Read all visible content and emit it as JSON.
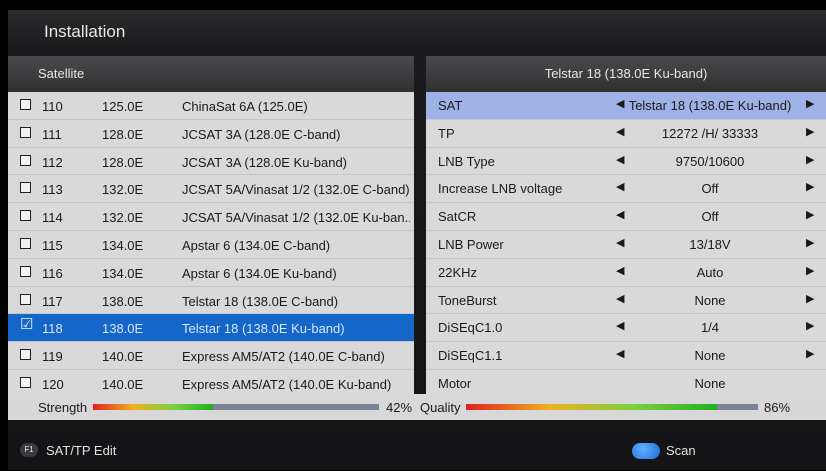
{
  "header": {
    "title": "Installation"
  },
  "left_panel": {
    "title": "Satellite",
    "rows": [
      {
        "num": "110",
        "pos": "125.0E",
        "name": "ChinaSat 6A (125.0E)",
        "checked": false
      },
      {
        "num": "111",
        "pos": "128.0E",
        "name": "JCSAT 3A (128.0E C-band)",
        "checked": false
      },
      {
        "num": "112",
        "pos": "128.0E",
        "name": "JCSAT 3A (128.0E Ku-band)",
        "checked": false
      },
      {
        "num": "113",
        "pos": "132.0E",
        "name": "JCSAT 5A/Vinasat 1/2 (132.0E C-band)",
        "checked": false
      },
      {
        "num": "114",
        "pos": "132.0E",
        "name": "JCSAT 5A/Vinasat 1/2 (132.0E Ku-ban...",
        "checked": false
      },
      {
        "num": "115",
        "pos": "134.0E",
        "name": "Apstar 6 (134.0E C-band)",
        "checked": false
      },
      {
        "num": "116",
        "pos": "134.0E",
        "name": "Apstar 6 (134.0E Ku-band)",
        "checked": false
      },
      {
        "num": "117",
        "pos": "138.0E",
        "name": "Telstar 18 (138.0E C-band)",
        "checked": false
      },
      {
        "num": "118",
        "pos": "138.0E",
        "name": "Telstar 18 (138.0E Ku-band)",
        "checked": true,
        "selected": true
      },
      {
        "num": "119",
        "pos": "140.0E",
        "name": "Express AM5/AT2 (140.0E C-band)",
        "checked": false
      },
      {
        "num": "120",
        "pos": "140.0E",
        "name": "Express AM5/AT2 (140.0E Ku-band)",
        "checked": false
      }
    ]
  },
  "right_panel": {
    "title": "Telstar 18 (138.0E Ku-band)",
    "params": [
      {
        "label": "SAT",
        "value": "Telstar 18 (138.0E Ku-band)",
        "arrows": true,
        "selected": true
      },
      {
        "label": "TP",
        "value": "12272 /H/ 33333",
        "arrows": true
      },
      {
        "label": "LNB Type",
        "value": "9750/10600",
        "arrows": true
      },
      {
        "label": "Increase LNB voltage",
        "value": "Off",
        "arrows": true
      },
      {
        "label": "SatCR",
        "value": "Off",
        "arrows": true
      },
      {
        "label": "LNB Power",
        "value": "13/18V",
        "arrows": true
      },
      {
        "label": "22KHz",
        "value": "Auto",
        "arrows": true
      },
      {
        "label": "ToneBurst",
        "value": "None",
        "arrows": true
      },
      {
        "label": "DiSEqC1.0",
        "value": "1/4",
        "arrows": true
      },
      {
        "label": "DiSEqC1.1",
        "value": "None",
        "arrows": true
      },
      {
        "label": "Motor",
        "value": "None",
        "arrows": false
      }
    ]
  },
  "signal": {
    "strength_label": "Strength",
    "strength_value": "42%",
    "strength_fraction": 0.42,
    "quality_label": "Quality",
    "quality_value": "86%",
    "quality_fraction": 0.86
  },
  "footer": {
    "f1_key": "F1",
    "f1_label": "SAT/TP Edit",
    "scan_label": "Scan"
  },
  "icons": {
    "left_arrow": "◀",
    "right_arrow": "▶",
    "check": "☑"
  },
  "colors": {
    "selected_row": "#1466c8",
    "selected_param": "#9fb2e8",
    "bar_gradient": [
      "#e02020",
      "#f0b020",
      "#7ad040",
      "#20b020"
    ]
  }
}
